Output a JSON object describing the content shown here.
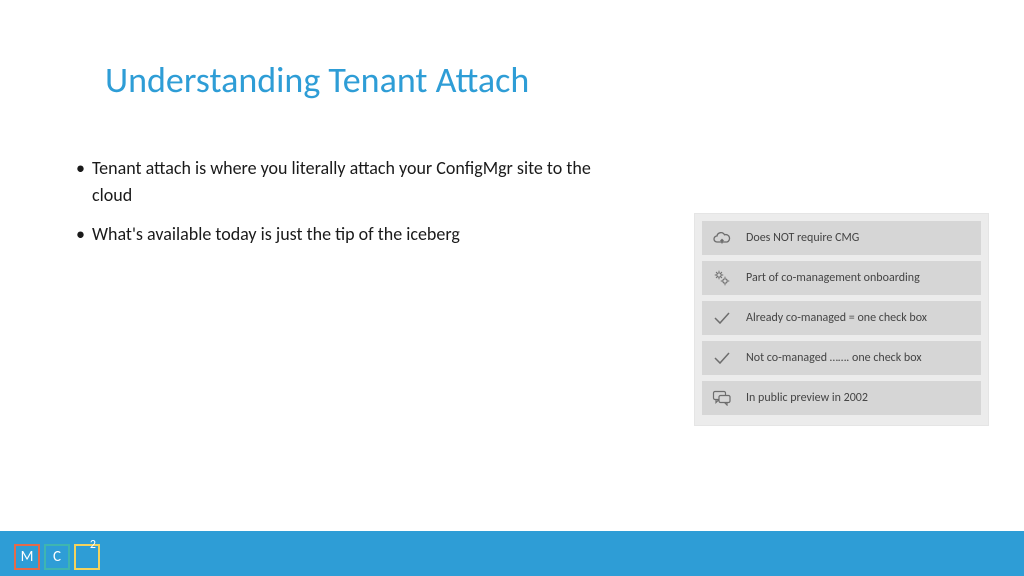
{
  "title": "Understanding Tenant Attach",
  "bullets": [
    "Tenant attach is where you literally attach your ConfigMgr site to the cloud",
    "What's available today is just the tip of the iceberg"
  ],
  "features": [
    {
      "icon": "cloud",
      "label": "Does NOT require CMG"
    },
    {
      "icon": "gears",
      "label": "Part of co-management onboarding"
    },
    {
      "icon": "check",
      "label": "Already co-managed = one check box"
    },
    {
      "icon": "check",
      "label": "Not co-managed ……. one check box"
    },
    {
      "icon": "chat",
      "label": "In public preview in 2002"
    }
  ],
  "logo": {
    "m": "M",
    "c": "C",
    "two": "2"
  }
}
